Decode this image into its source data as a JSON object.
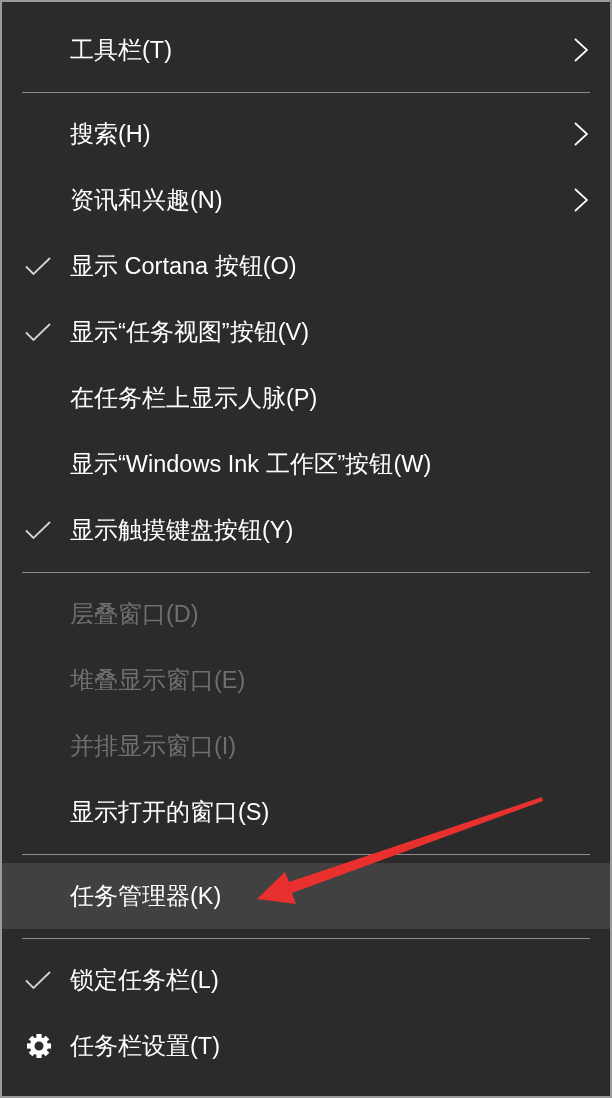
{
  "menu": {
    "sections": [
      {
        "items": [
          {
            "label": "工具栏(T)",
            "kind": "submenu",
            "checked": false,
            "disabled": false,
            "highlighted": false
          }
        ]
      },
      {
        "items": [
          {
            "label": "搜索(H)",
            "kind": "submenu",
            "checked": false,
            "disabled": false,
            "highlighted": false
          },
          {
            "label": "资讯和兴趣(N)",
            "kind": "submenu",
            "checked": false,
            "disabled": false,
            "highlighted": false
          },
          {
            "label": "显示 Cortana 按钮(O)",
            "kind": "command",
            "checked": true,
            "disabled": false,
            "highlighted": false
          },
          {
            "label": "显示“任务视图”按钮(V)",
            "kind": "command",
            "checked": true,
            "disabled": false,
            "highlighted": false
          },
          {
            "label": "在任务栏上显示人脉(P)",
            "kind": "command",
            "checked": false,
            "disabled": false,
            "highlighted": false
          },
          {
            "label": "显示“Windows Ink 工作区”按钮(W)",
            "kind": "command",
            "checked": false,
            "disabled": false,
            "highlighted": false
          },
          {
            "label": "显示触摸键盘按钮(Y)",
            "kind": "command",
            "checked": true,
            "disabled": false,
            "highlighted": false
          }
        ]
      },
      {
        "items": [
          {
            "label": "层叠窗口(D)",
            "kind": "command",
            "checked": false,
            "disabled": true,
            "highlighted": false
          },
          {
            "label": "堆叠显示窗口(E)",
            "kind": "command",
            "checked": false,
            "disabled": true,
            "highlighted": false
          },
          {
            "label": "并排显示窗口(I)",
            "kind": "command",
            "checked": false,
            "disabled": true,
            "highlighted": false
          },
          {
            "label": "显示打开的窗口(S)",
            "kind": "command",
            "checked": false,
            "disabled": false,
            "highlighted": false
          }
        ]
      },
      {
        "items": [
          {
            "label": "任务管理器(K)",
            "kind": "command",
            "checked": false,
            "disabled": false,
            "highlighted": true
          }
        ]
      },
      {
        "items": [
          {
            "label": "锁定任务栏(L)",
            "kind": "command",
            "checked": true,
            "disabled": false,
            "highlighted": false
          },
          {
            "label": "任务栏设置(T)",
            "kind": "settings",
            "checked": false,
            "disabled": false,
            "highlighted": false
          }
        ]
      }
    ]
  }
}
